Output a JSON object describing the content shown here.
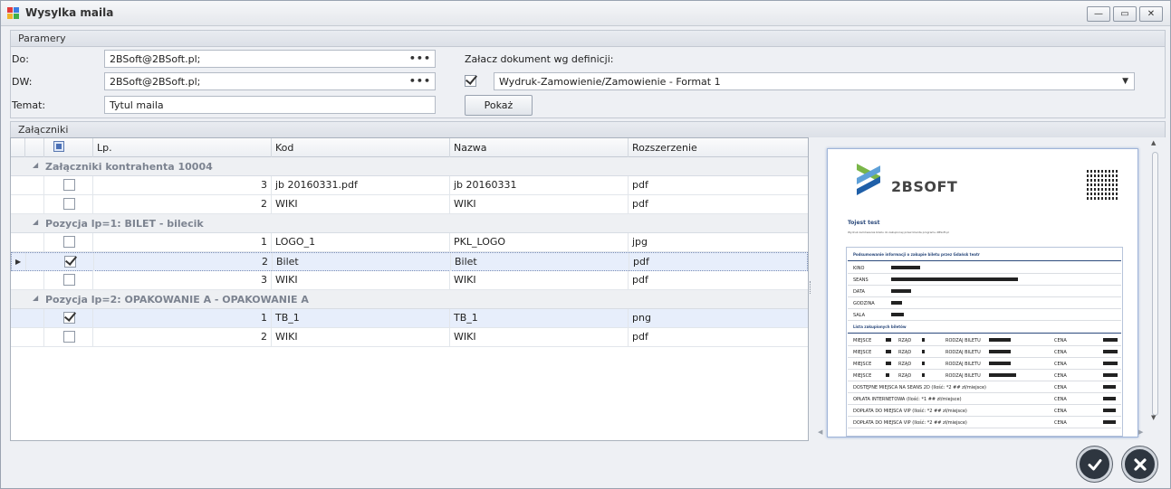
{
  "window": {
    "title": "Wysylka maila",
    "minimize": "—",
    "maximize": "▭",
    "close": "✕"
  },
  "params": {
    "section_title": "Paramery",
    "to_label": "Do:",
    "to_value": "2BSoft@2BSoft.pl;",
    "cc_label": "DW:",
    "cc_value": "2BSoft@2BSoft.pl;",
    "subject_label": "Temat:",
    "subject_value": "Tytul maila",
    "ellipsis": "•••",
    "attach_doc_label": "Załacz dokument  wg definicji:",
    "attach_doc_checked": true,
    "definition_value": "Wydruk-Zamowienie/Zamowienie - Format 1",
    "show_button": "Pokaż"
  },
  "attachments": {
    "section_title": "Załączniki",
    "columns": [
      "Lp.",
      "Kod",
      "Nazwa",
      "Rozszerzenie"
    ],
    "groups": [
      {
        "title": "Załączniki kontrahenta 10004",
        "rows": [
          {
            "checked": false,
            "lp": "3",
            "kod": "jb 20160331.pdf",
            "nazwa": "jb 20160331",
            "ext": "pdf"
          },
          {
            "checked": false,
            "lp": "2",
            "kod": "WIKI",
            "nazwa": "WIKI",
            "ext": "pdf"
          }
        ]
      },
      {
        "title": "Pozycja lp=1:  BILET - bilecik",
        "rows": [
          {
            "checked": false,
            "lp": "1",
            "kod": "LOGO_1",
            "nazwa": "PKL_LOGO",
            "ext": "jpg"
          },
          {
            "checked": true,
            "lp": "2",
            "kod": "Bilet",
            "nazwa": "Bilet",
            "ext": "pdf"
          },
          {
            "checked": false,
            "lp": "3",
            "kod": "WIKI",
            "nazwa": "WIKI",
            "ext": "pdf"
          }
        ]
      },
      {
        "title": "Pozycja lp=2:  OPAKOWANIE A - OPAKOWANIE A",
        "rows": [
          {
            "checked": true,
            "lp": "1",
            "kod": "TB_1",
            "nazwa": "TB_1",
            "ext": "png"
          },
          {
            "checked": false,
            "lp": "2",
            "kod": "WIKI",
            "nazwa": "WIKI",
            "ext": "pdf"
          }
        ]
      }
    ]
  },
  "preview": {
    "logo_text": "2BSOFT",
    "doc_title": "Tojest test",
    "doc_subtitle": "Wydruk zamówienia biletu do zakupionej przez klienta programu 2BSoft.pl",
    "box_title": "Podsumowanie informacji o zakupie biletu przez Gdańsk teatr",
    "info_labels": [
      "KINO",
      "SEANS",
      "DATA",
      "GODZINA",
      "SALA"
    ],
    "list_title": "Lista zakupionych biletów",
    "seat_labels": [
      "MIEJSCE",
      "RZĄD",
      "RODZAJ BILETU",
      "CENA"
    ],
    "extra_rows": [
      "DOSTĘPNE MIEJSCA NA SEANS 2D (Ilość: *2 ## zł/miejsce)",
      "OPŁATA INTERNETOWA (Ilość: *1 ## zł/miejsce)",
      "DOPŁATA DO MIEJSCA VIP (Ilość: *2 ## zł/miejsce)",
      "DOPŁATA DO MIEJSCA VIP (Ilość: *2 ## zł/miejsce)"
    ]
  },
  "actions": {
    "ok_icon": "check-icon",
    "cancel_icon": "cancel-icon"
  },
  "colors": {
    "accent": "#2c5aa0",
    "selection": "#e7eefb",
    "logo_green": "#7ab648",
    "logo_blue": "#1f5fa8"
  }
}
